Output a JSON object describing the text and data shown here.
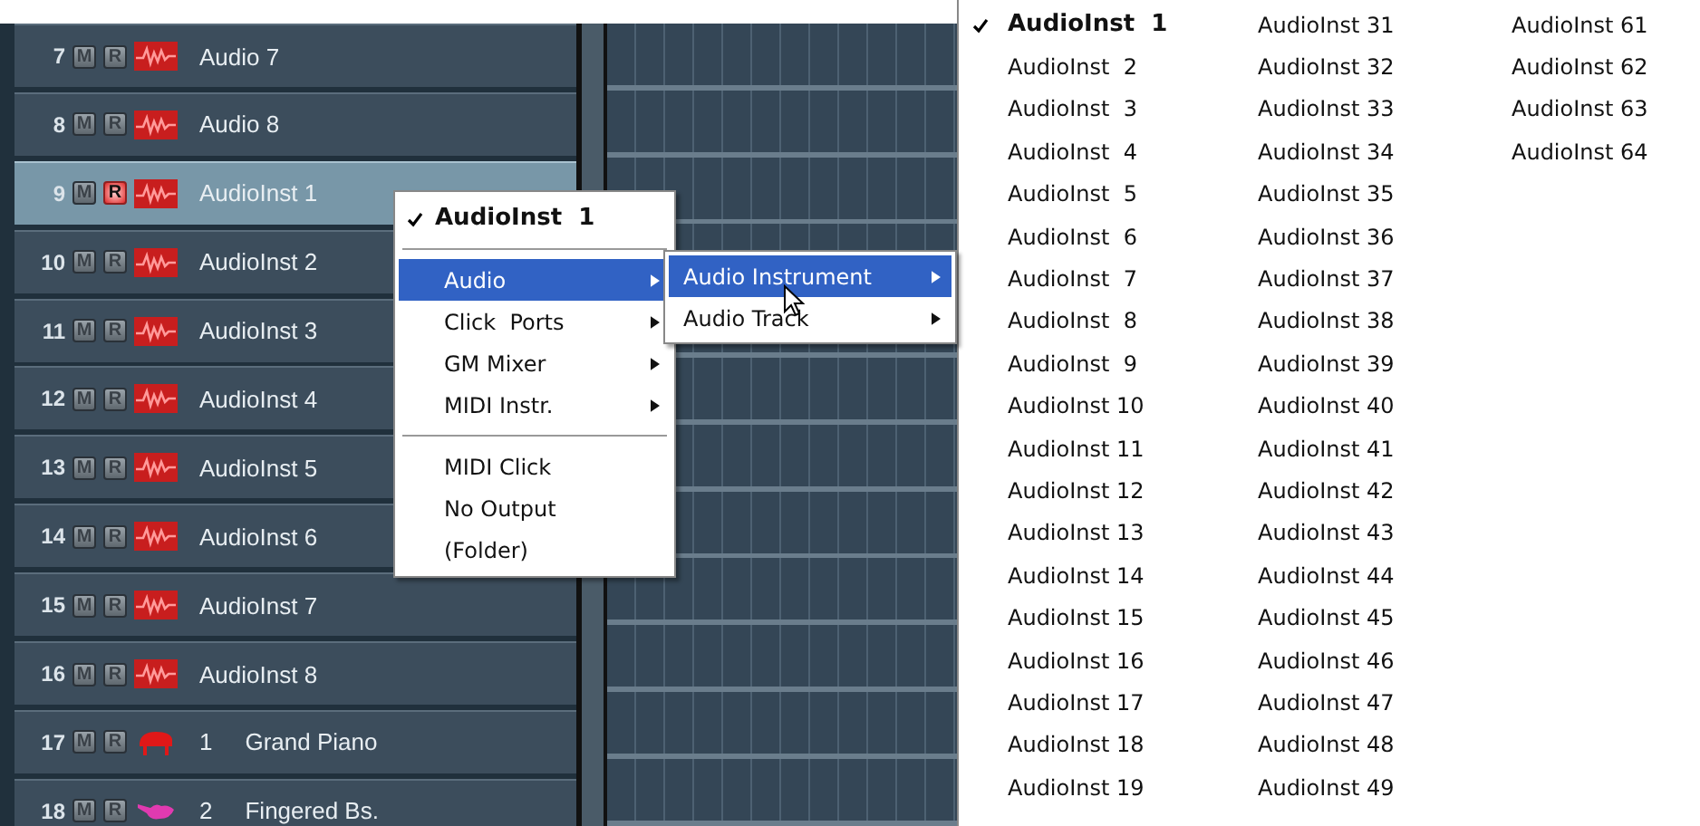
{
  "tracks": [
    {
      "number": "7",
      "kind": "audio",
      "name": "Audio 7",
      "selected": false,
      "mute_label": "M",
      "record_label": "R",
      "record": false
    },
    {
      "number": "8",
      "kind": "audio",
      "name": "Audio 8",
      "selected": false,
      "mute_label": "M",
      "record_label": "R",
      "record": false
    },
    {
      "number": "9",
      "kind": "audio",
      "name": "AudioInst 1",
      "selected": true,
      "mute_label": "M",
      "record_label": "R",
      "record": true
    },
    {
      "number": "10",
      "kind": "audio",
      "name": "AudioInst 2",
      "selected": false,
      "mute_label": "M",
      "record_label": "R",
      "record": false
    },
    {
      "number": "11",
      "kind": "audio",
      "name": "AudioInst 3",
      "selected": false,
      "mute_label": "M",
      "record_label": "R",
      "record": false
    },
    {
      "number": "12",
      "kind": "audio",
      "name": "AudioInst 4",
      "selected": false,
      "mute_label": "M",
      "record_label": "R",
      "record": false
    },
    {
      "number": "13",
      "kind": "audio",
      "name": "AudioInst 5",
      "selected": false,
      "mute_label": "M",
      "record_label": "R",
      "record": false
    },
    {
      "number": "14",
      "kind": "audio",
      "name": "AudioInst 6",
      "selected": false,
      "mute_label": "M",
      "record_label": "R",
      "record": false
    },
    {
      "number": "15",
      "kind": "audio",
      "name": "AudioInst 7",
      "selected": false,
      "mute_label": "M",
      "record_label": "R",
      "record": false
    },
    {
      "number": "16",
      "kind": "audio",
      "name": "AudioInst 8",
      "selected": false,
      "mute_label": "M",
      "record_label": "R",
      "record": false
    },
    {
      "number": "17",
      "kind": "piano",
      "program": "1",
      "name": "Grand Piano",
      "selected": false,
      "mute_label": "M",
      "record_label": "R",
      "record": false
    },
    {
      "number": "18",
      "kind": "bass",
      "program": "2",
      "name": "Fingered Bs.",
      "selected": false,
      "mute_label": "M",
      "record_label": "R",
      "record": false
    }
  ],
  "context_menu": {
    "sections": [
      [
        {
          "label": "AudioInst  1",
          "checked": true,
          "submenu": false,
          "selected": false
        }
      ],
      [
        {
          "label": "Audio",
          "checked": false,
          "submenu": true,
          "selected": true
        },
        {
          "label": "Click  Ports",
          "checked": false,
          "submenu": true,
          "selected": false
        },
        {
          "label": "GM Mixer",
          "checked": false,
          "submenu": true,
          "selected": false
        },
        {
          "label": "MIDI Instr.",
          "checked": false,
          "submenu": true,
          "selected": false
        }
      ],
      [
        {
          "label": "MIDI Click",
          "checked": false,
          "submenu": false,
          "selected": false
        },
        {
          "label": "No Output",
          "checked": false,
          "submenu": false,
          "selected": false
        },
        {
          "label": "(Folder)",
          "checked": false,
          "submenu": false,
          "selected": false
        }
      ]
    ]
  },
  "submenu": [
    {
      "label": "Audio Instrument",
      "selected": true
    },
    {
      "label": "Audio Track",
      "selected": false
    }
  ],
  "instrument_menu": {
    "columns": [
      [
        {
          "label": "AudioInst  1",
          "checked": true
        },
        {
          "label": "AudioInst  2",
          "checked": false
        },
        {
          "label": "AudioInst  3",
          "checked": false
        },
        {
          "label": "AudioInst  4",
          "checked": false
        },
        {
          "label": "AudioInst  5",
          "checked": false
        },
        {
          "label": "AudioInst  6",
          "checked": false
        },
        {
          "label": "AudioInst  7",
          "checked": false
        },
        {
          "label": "AudioInst  8",
          "checked": false
        },
        {
          "label": "AudioInst  9",
          "checked": false
        },
        {
          "label": "AudioInst 10",
          "checked": false
        },
        {
          "label": "AudioInst 11",
          "checked": false
        },
        {
          "label": "AudioInst 12",
          "checked": false
        },
        {
          "label": "AudioInst 13",
          "checked": false
        },
        {
          "label": "AudioInst 14",
          "checked": false
        },
        {
          "label": "AudioInst 15",
          "checked": false
        },
        {
          "label": "AudioInst 16",
          "checked": false
        },
        {
          "label": "AudioInst 17",
          "checked": false
        },
        {
          "label": "AudioInst 18",
          "checked": false
        },
        {
          "label": "AudioInst 19",
          "checked": false
        }
      ],
      [
        {
          "label": "AudioInst 31",
          "checked": false
        },
        {
          "label": "AudioInst 32",
          "checked": false
        },
        {
          "label": "AudioInst 33",
          "checked": false
        },
        {
          "label": "AudioInst 34",
          "checked": false
        },
        {
          "label": "AudioInst 35",
          "checked": false
        },
        {
          "label": "AudioInst 36",
          "checked": false
        },
        {
          "label": "AudioInst 37",
          "checked": false
        },
        {
          "label": "AudioInst 38",
          "checked": false
        },
        {
          "label": "AudioInst 39",
          "checked": false
        },
        {
          "label": "AudioInst 40",
          "checked": false
        },
        {
          "label": "AudioInst 41",
          "checked": false
        },
        {
          "label": "AudioInst 42",
          "checked": false
        },
        {
          "label": "AudioInst 43",
          "checked": false
        },
        {
          "label": "AudioInst 44",
          "checked": false
        },
        {
          "label": "AudioInst 45",
          "checked": false
        },
        {
          "label": "AudioInst 46",
          "checked": false
        },
        {
          "label": "AudioInst 47",
          "checked": false
        },
        {
          "label": "AudioInst 48",
          "checked": false
        },
        {
          "label": "AudioInst 49",
          "checked": false
        }
      ],
      [
        {
          "label": "AudioInst 61",
          "checked": false
        },
        {
          "label": "AudioInst 62",
          "checked": false
        },
        {
          "label": "AudioInst 63",
          "checked": false
        },
        {
          "label": "AudioInst 64",
          "checked": false
        }
      ]
    ]
  }
}
